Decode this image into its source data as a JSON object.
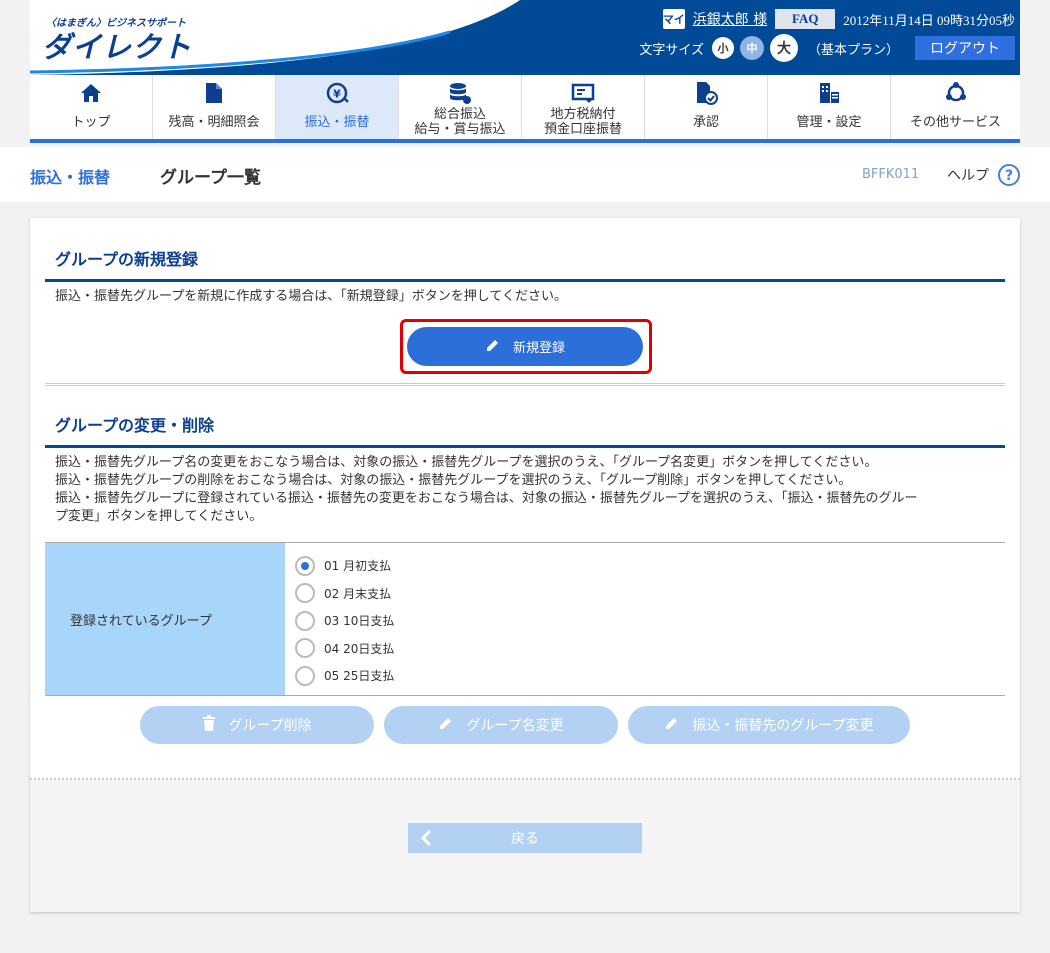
{
  "header": {
    "logo_sub": "〈はまぎん〉ビジネスサポート",
    "logo_main": "ダイレクト",
    "user_icon_text": "マイ",
    "user_name": "浜銀太郎 様",
    "faq_label": "FAQ",
    "datetime": "2012年11月14日 09時31分05秒",
    "font_size_label": "文字サイズ",
    "font_small": "小",
    "font_medium": "中",
    "font_large": "大",
    "plan": "（基本プラン）",
    "logout_label": "ログアウト"
  },
  "nav": {
    "items": [
      {
        "label": "トップ",
        "icon": "home-icon"
      },
      {
        "label": "残高・明細照会",
        "icon": "document-icon"
      },
      {
        "label": "振込・振替",
        "icon": "yen-transfer-icon",
        "active": true
      },
      {
        "label_line1": "総合振込",
        "label_line2": "給与・賞与振込",
        "icon": "database-icon"
      },
      {
        "label_line1": "地方税納付",
        "label_line2": "預金口座振替",
        "icon": "tax-payment-icon"
      },
      {
        "label": "承認",
        "icon": "approval-icon"
      },
      {
        "label": "管理・設定",
        "icon": "management-icon"
      },
      {
        "label": "その他サービス",
        "icon": "other-services-icon"
      }
    ]
  },
  "title_bar": {
    "breadcrumb": "振込・振替",
    "page_title": "グループ一覧",
    "screen_id": "BFFK011",
    "help_label": "ヘルプ"
  },
  "new_section": {
    "title": "グループの新規登録",
    "description": "振込・振替先グループを新規に作成する場合は、「新規登録」ボタンを押してください。",
    "new_button_label": "新規登録"
  },
  "edit_section": {
    "title": "グループの変更・削除",
    "description_lines": [
      "振込・振替先グループ名の変更をおこなう場合は、対象の振込・振替先グループを選択のうえ、「グループ名変更」ボタンを押してください。",
      "振込・振替先グループの削除をおこなう場合は、対象の振込・振替先グループを選択のうえ、「グループ削除」ボタンを押してください。",
      "振込・振替先グループに登録されている振込・振替先の変更をおこなう場合は、対象の振込・振替先グループを選択のうえ、「振込・振替先のグルー",
      "プ変更」ボタンを押してください。"
    ],
    "table_header": "登録されているグループ",
    "groups": [
      {
        "label": "01 月初支払",
        "checked": true
      },
      {
        "label": "02 月末支払",
        "checked": false
      },
      {
        "label": "03 10日支払",
        "checked": false
      },
      {
        "label": "04 20日支払",
        "checked": false
      },
      {
        "label": "05 25日支払",
        "checked": false
      }
    ],
    "delete_button_label": "グループ削除",
    "rename_button_label": "グループ名変更",
    "change_group_button_label": "振込・振替先のグループ変更"
  },
  "footer": {
    "back_button_label": "戻る"
  }
}
